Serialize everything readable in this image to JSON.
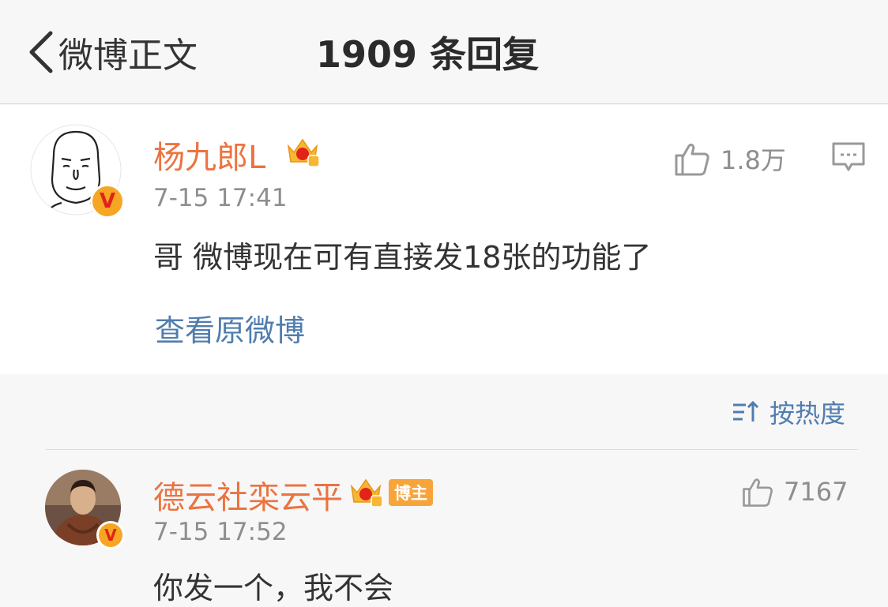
{
  "navbar": {
    "back_label": "微博正文",
    "title": "1909 条回复"
  },
  "main_comment": {
    "username": "杨九郎L",
    "time": "7-15 17:41",
    "text": "哥 微博现在可有直接发18张的功能了",
    "like_count": "1.8万",
    "view_original": "查看原微博",
    "verified_mark": "V"
  },
  "sort": {
    "label": "按热度"
  },
  "replies": [
    {
      "username": "德云社栾云平",
      "badge": "博主",
      "time": "7-15 17:52",
      "text": "你发一个，我不会",
      "like_count": "7167",
      "verified_mark": "V"
    }
  ],
  "colors": {
    "username": "#eb7340",
    "link": "#507daf",
    "meta": "#8e8e8e"
  }
}
